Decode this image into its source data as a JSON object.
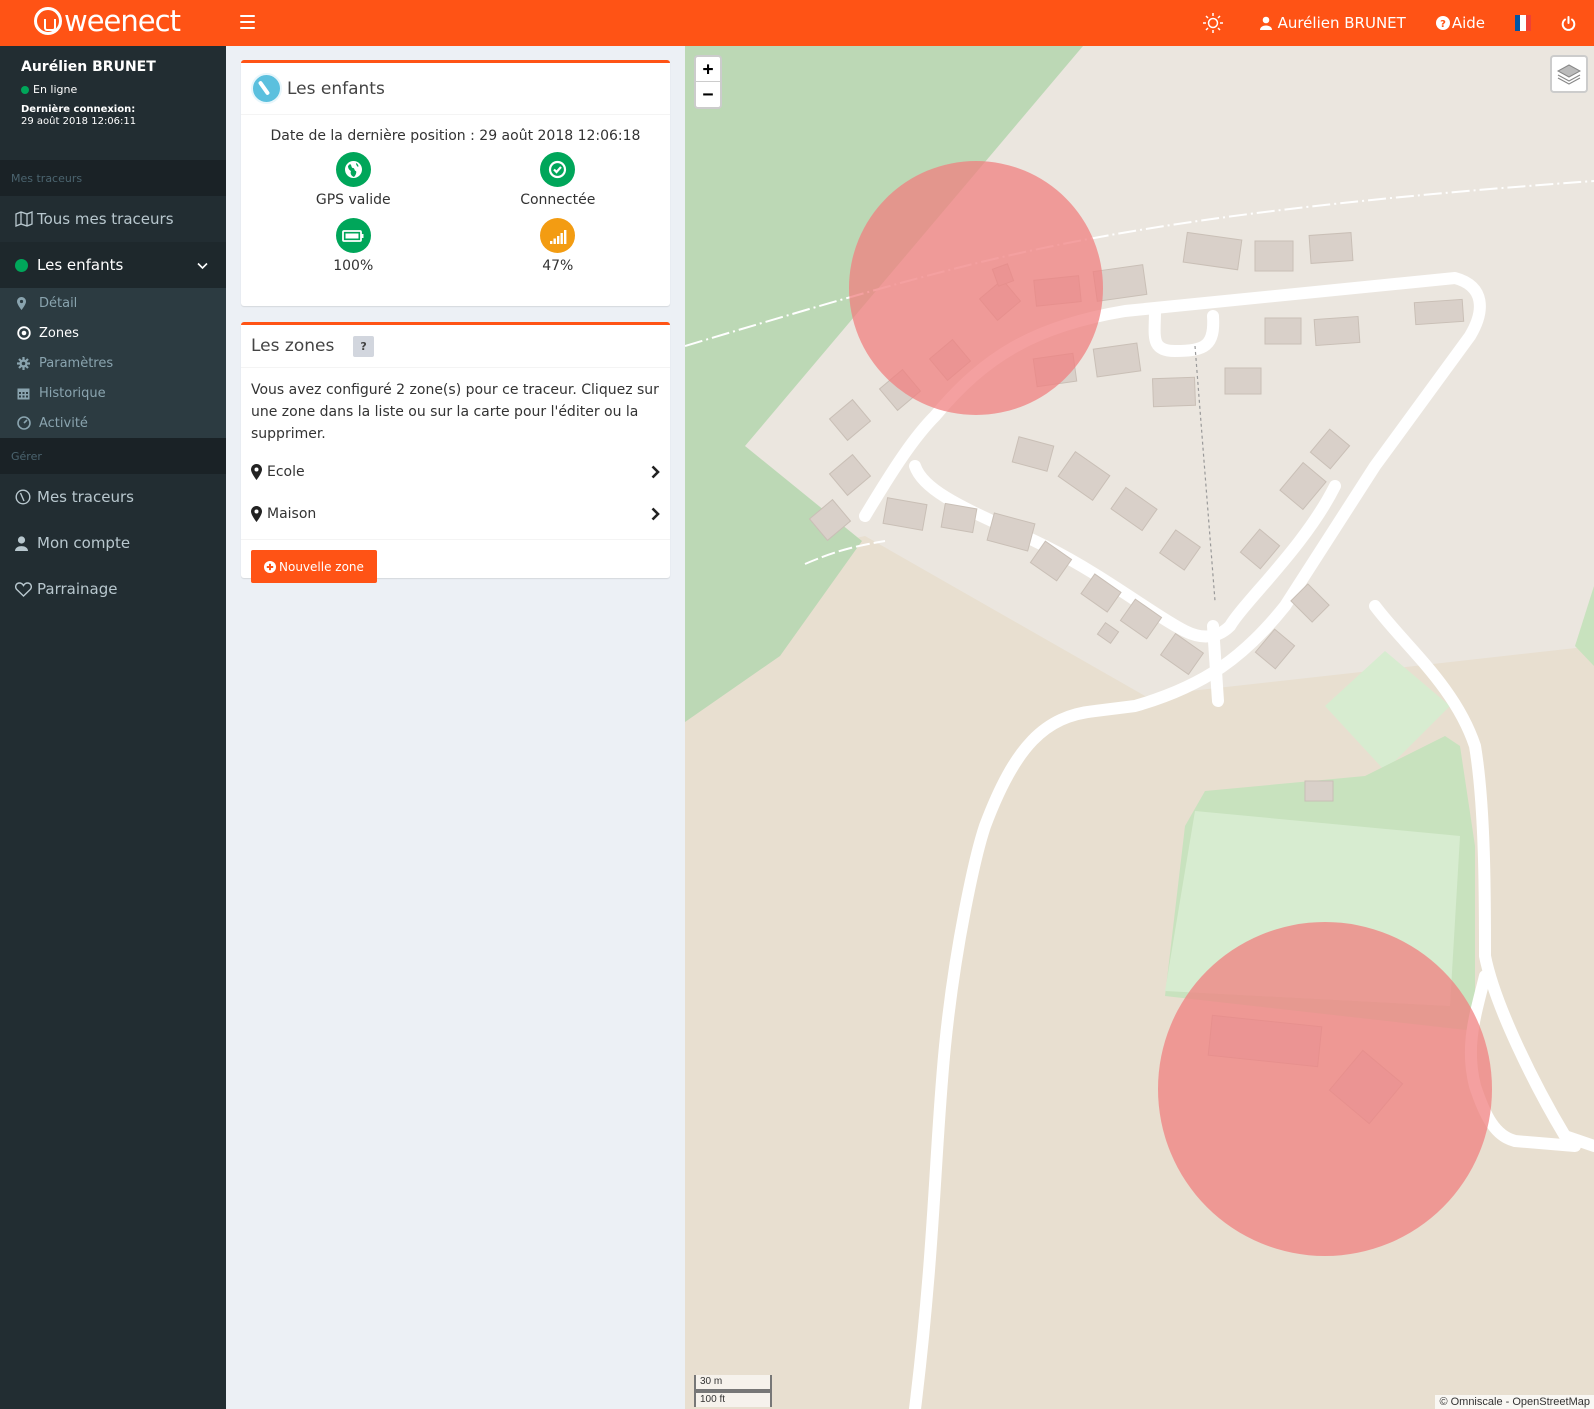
{
  "header": {
    "logo_text": "weenect",
    "user_label": "Aurélien BRUNET",
    "help_label": "Aide",
    "brand_color": "#ff5315"
  },
  "sidebar": {
    "user_name": "Aurélien BRUNET",
    "status": "En ligne",
    "last_connection_label": "Dernière connexion:",
    "last_connection_date": "29 août 2018 12:06:11",
    "section_trackers": "Mes traceurs",
    "all_trackers": "Tous mes traceurs",
    "tracker_name": "Les enfants",
    "submenu": [
      {
        "label": "Détail",
        "icon": "map-pin-icon"
      },
      {
        "label": "Zones",
        "icon": "target-icon"
      },
      {
        "label": "Paramètres",
        "icon": "gear-icon"
      },
      {
        "label": "Historique",
        "icon": "calendar-icon"
      },
      {
        "label": "Activité",
        "icon": "dashboard-icon"
      }
    ],
    "section_manage": "Gérer",
    "manage_items": [
      {
        "label": "Mes traceurs",
        "icon": "tracker-icon"
      },
      {
        "label": "Mon compte",
        "icon": "user-icon"
      },
      {
        "label": "Parrainage",
        "icon": "heart-icon"
      }
    ]
  },
  "tracker_box": {
    "title": "Les enfants",
    "last_position": "Date de la dernière position : 29 août 2018 12:06:18",
    "stats": [
      {
        "label": "GPS valide",
        "icon": "globe-icon",
        "color": "#00a65a"
      },
      {
        "label": "Connectée",
        "icon": "check-circle-icon",
        "color": "#00a65a"
      },
      {
        "label": "100%",
        "icon": "battery-icon",
        "color": "#00a65a"
      },
      {
        "label": "47%",
        "icon": "signal-icon",
        "color": "#f39c12"
      }
    ]
  },
  "zones_box": {
    "title": "Les zones",
    "help": "?",
    "description": "Vous avez configuré 2 zone(s) pour ce traceur. Cliquez sur une zone dans la liste ou sur la carte pour l'éditer ou la supprimer.",
    "zones": [
      {
        "name": "Ecole"
      },
      {
        "name": "Maison"
      }
    ],
    "new_zone_label": "Nouvelle zone"
  },
  "map": {
    "zoom_in": "+",
    "zoom_out": "−",
    "scale_metric": "30 m",
    "scale_imperial": "100 ft",
    "attribution": "© Omniscale - OpenStreetMap",
    "zone_color": "#f08080"
  }
}
